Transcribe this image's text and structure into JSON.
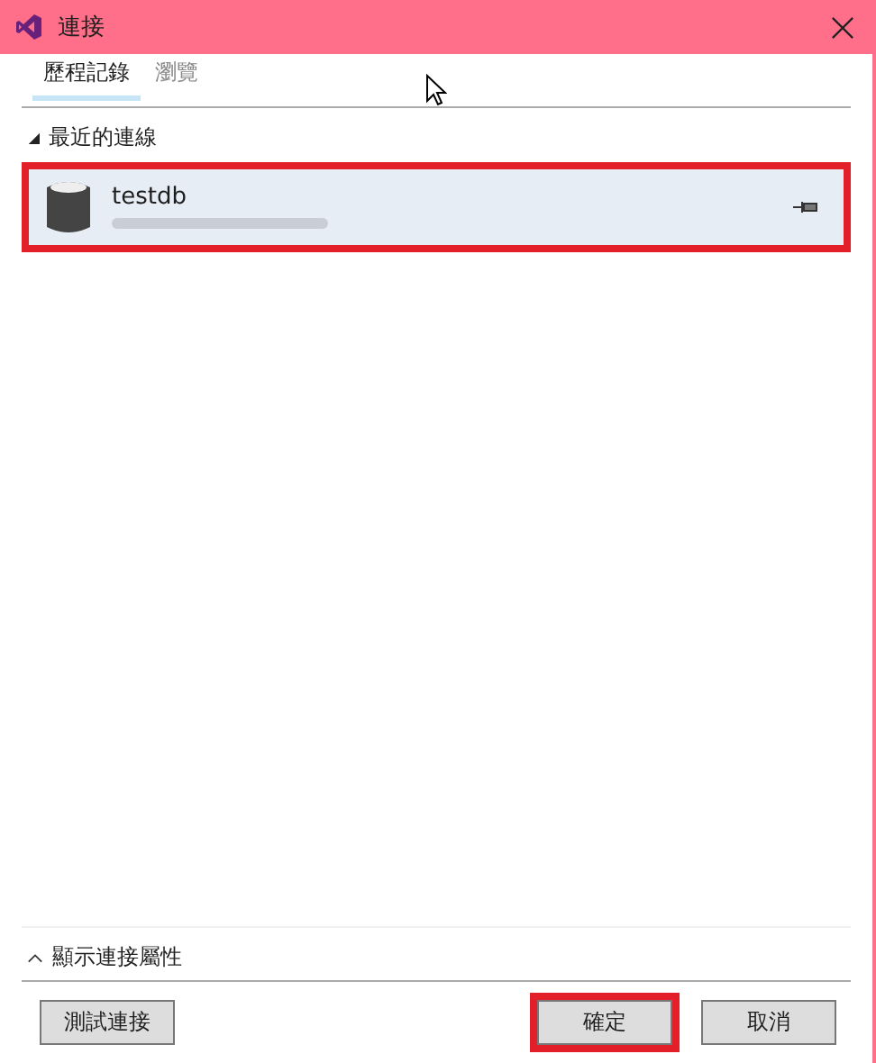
{
  "window": {
    "title": "連接"
  },
  "tabs": [
    {
      "label": "歷程記錄",
      "selected": true
    },
    {
      "label": "瀏覽",
      "selected": false
    }
  ],
  "section": {
    "label": "最近的連線",
    "expanded": true
  },
  "connections": [
    {
      "name": "testdb",
      "selected": true,
      "highlighted": true
    }
  ],
  "properties_toggle": {
    "label": "顯示連接屬性",
    "expanded": false
  },
  "buttons": [
    {
      "label": "測試連接",
      "highlighted": false
    },
    {
      "label": "確定",
      "highlighted": true
    },
    {
      "label": "取消",
      "highlighted": false
    }
  ]
}
